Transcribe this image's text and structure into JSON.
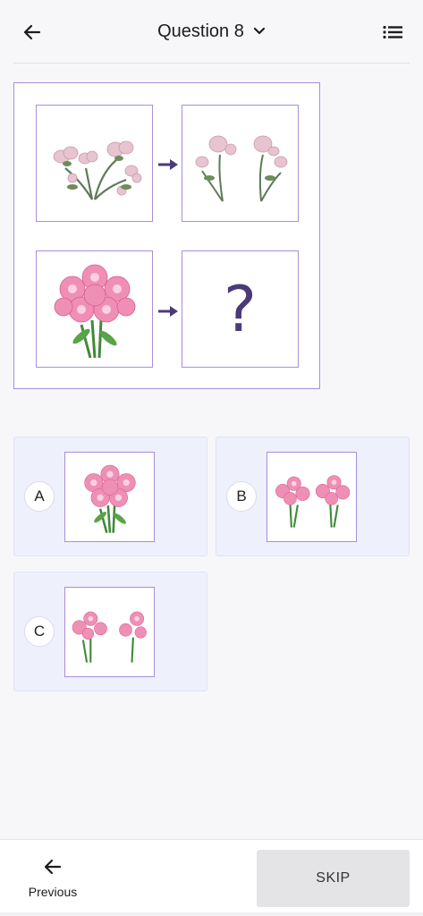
{
  "header": {
    "back_icon": "arrow-left-icon",
    "title": "Question 8",
    "dropdown_icon": "chevron-down-icon",
    "menu_icon": "list-icon"
  },
  "puzzle": {
    "pair1": {
      "from": "pink blossom branch (single)",
      "to": "two pink blossom branches"
    },
    "pair2": {
      "from": "pink lily bouquet (single)",
      "to": "?"
    },
    "question_mark": "?",
    "arrow_color": "#4b3a7a"
  },
  "options": [
    {
      "letter": "A",
      "image": "single pink lily bouquet"
    },
    {
      "letter": "B",
      "image": "two pink lily bouquets"
    },
    {
      "letter": "C",
      "image": "two small pink lily sprigs"
    }
  ],
  "footer": {
    "previous_icon": "arrow-left-icon",
    "previous_label": "Previous",
    "skip_label": "SKIP"
  },
  "colors": {
    "accent_border": "#a98fd8",
    "option_bg": "#eef0fb",
    "skip_bg": "#e4e4e6"
  }
}
